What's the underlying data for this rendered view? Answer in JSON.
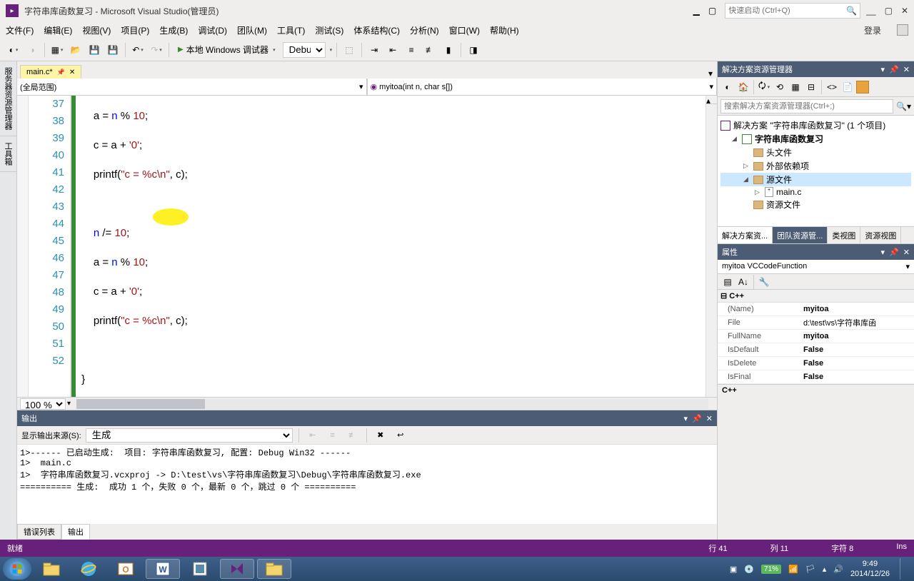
{
  "title": "字符串库函数复习 - Microsoft Visual Studio(管理员)",
  "quick_launch_placeholder": "快速启动 (Ctrl+Q)",
  "login": "登录",
  "menus": [
    "文件(F)",
    "编辑(E)",
    "视图(V)",
    "项目(P)",
    "生成(B)",
    "调试(D)",
    "团队(M)",
    "工具(T)",
    "测试(S)",
    "体系结构(C)",
    "分析(N)",
    "窗口(W)",
    "帮助(H)"
  ],
  "run_label": "本地 Windows 调试器",
  "config": "Debug",
  "file_tab": "main.c*",
  "scope_left": "(全局范围)",
  "scope_right": "myitoa(int n, char s[])",
  "sidebar_tabs": [
    "服务器资源管理器",
    "工具箱"
  ],
  "lines": [
    37,
    38,
    39,
    40,
    41,
    42,
    43,
    44,
    45,
    46,
    47,
    48,
    49,
    50,
    51,
    52
  ],
  "zoom": "100 %",
  "solution_explorer": {
    "title": "解决方案资源管理器",
    "search_placeholder": "搜索解决方案资源管理器(Ctrl+;)",
    "sln": "解决方案 \"字符串库函数复习\" (1 个项目)",
    "proj": "字符串库函数复习",
    "headers": "头文件",
    "external": "外部依赖项",
    "sources": "源文件",
    "main_file": "main.c",
    "resources": "资源文件",
    "tabs": [
      "解决方案资...",
      "团队资源管...",
      "类视图",
      "资源视图"
    ]
  },
  "properties": {
    "title": "属性",
    "obj": "myitoa VCCodeFunction",
    "cat": "C++",
    "rows": [
      {
        "name": "(Name)",
        "val": "myitoa"
      },
      {
        "name": "File",
        "val": "d:\\test\\vs\\字符串库函"
      },
      {
        "name": "FullName",
        "val": "myitoa"
      },
      {
        "name": "IsDefault",
        "val": "False"
      },
      {
        "name": "IsDelete",
        "val": "False"
      },
      {
        "name": "IsFinal",
        "val": "False"
      }
    ],
    "desc": "C++"
  },
  "output": {
    "title": "输出",
    "source_label": "显示输出来源(S):",
    "source": "生成",
    "text": "1>------ 已启动生成:  项目: 字符串库函数复习, 配置: Debug Win32 ------\n1>  main.c\n1>  字符串库函数复习.vcxproj -> D:\\test\\vs\\字符串库函数复习\\Debug\\字符串库函数复习.exe\n========== 生成:  成功 1 个，失败 0 个，最新 0 个，跳过 0 个 ==========",
    "tabs": [
      "错误列表",
      "输出"
    ]
  },
  "status": {
    "ready": "就绪",
    "line": "行 41",
    "col": "列 11",
    "char": "字符 8",
    "ins": "Ins"
  },
  "tray": {
    "battery": "71%",
    "time": "9:49",
    "date": "2014/12/26"
  }
}
